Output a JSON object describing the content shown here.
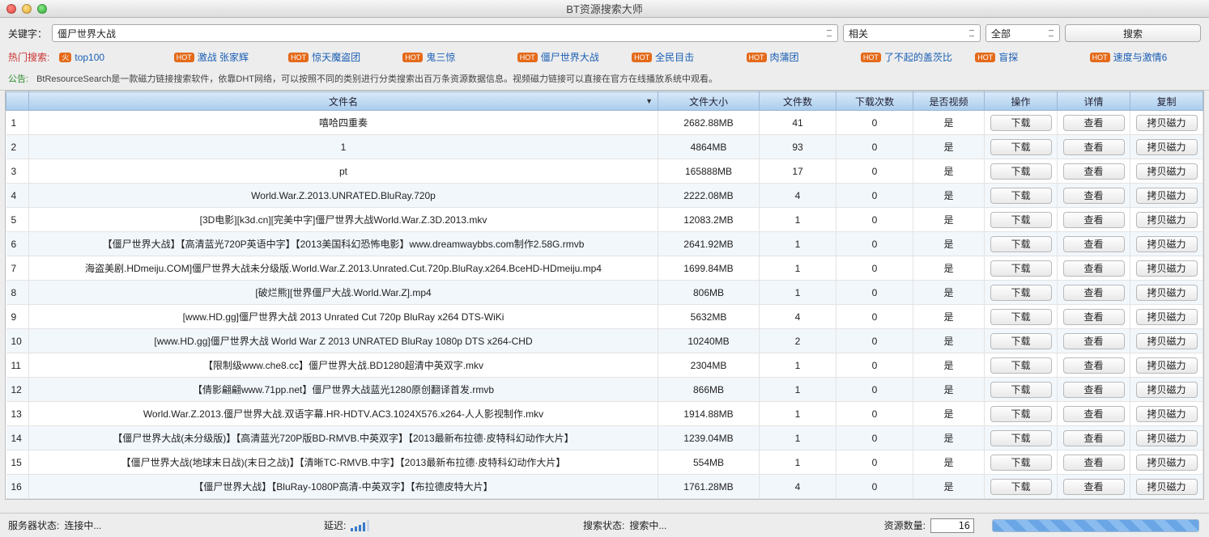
{
  "window": {
    "title": "BT资源搜索大师"
  },
  "search": {
    "keyword_label": "关键字：",
    "keyword_value": "僵尸世界大战",
    "sort_value": "相关",
    "filter_value": "全部",
    "button": "搜索"
  },
  "hot": {
    "label": "热门搜索:",
    "items": [
      {
        "badge_text": "火",
        "text": "top100"
      },
      {
        "badge_text": "HOT",
        "text": "激战 张家辉"
      },
      {
        "badge_text": "HOT",
        "text": "惊天魔盗团"
      },
      {
        "badge_text": "HOT",
        "text": "鬼三惊"
      },
      {
        "badge_text": "HOT",
        "text": "僵尸世界大战"
      },
      {
        "badge_text": "HOT",
        "text": "全民目击"
      },
      {
        "badge_text": "HOT",
        "text": "肉蒲团"
      },
      {
        "badge_text": "HOT",
        "text": "了不起的盖茨比"
      },
      {
        "badge_text": "HOT",
        "text": "盲探"
      },
      {
        "badge_text": "HOT",
        "text": "速度与激情6"
      }
    ]
  },
  "notice": {
    "label": "公告:",
    "text": "BtResourceSearch是一款磁力链接搜索软件，依靠DHT网络，可以按照不同的类别进行分类搜索出百万条资源数据信息。视频磁力链接可以直接在官方在线播放系统中观看。"
  },
  "table": {
    "headers": {
      "name": "文件名",
      "size": "文件大小",
      "files": "文件数",
      "downloads": "下载次数",
      "video": "是否视频",
      "action": "操作",
      "detail": "详情",
      "copy": "复制"
    },
    "buttons": {
      "download": "下载",
      "view": "查看",
      "copy": "拷贝磁力"
    },
    "rows": [
      {
        "idx": "1",
        "name": "嘻哈四重奏",
        "size": "2682.88MB",
        "files": "41",
        "dl": "0",
        "video": "是"
      },
      {
        "idx": "2",
        "name": "1",
        "size": "4864MB",
        "files": "93",
        "dl": "0",
        "video": "是"
      },
      {
        "idx": "3",
        "name": "pt",
        "size": "165888MB",
        "files": "17",
        "dl": "0",
        "video": "是"
      },
      {
        "idx": "4",
        "name": "World.War.Z.2013.UNRATED.BluRay.720p",
        "size": "2222.08MB",
        "files": "4",
        "dl": "0",
        "video": "是"
      },
      {
        "idx": "5",
        "name": "[3D电影][k3d.cn][完美中字]僵尸世界大战World.War.Z.3D.2013.mkv",
        "size": "12083.2MB",
        "files": "1",
        "dl": "0",
        "video": "是"
      },
      {
        "idx": "6",
        "name": "【僵尸世界大战】【高清蓝光720P英语中字】【2013美国科幻恐怖电影】www.dreamwaybbs.com制作2.58G.rmvb",
        "size": "2641.92MB",
        "files": "1",
        "dl": "0",
        "video": "是"
      },
      {
        "idx": "7",
        "name": "海盗美剧.HDmeiju.COM]僵尸世界大战未分级版.World.War.Z.2013.Unrated.Cut.720p.BluRay.x264.BceHD-HDmeiju.mp4",
        "size": "1699.84MB",
        "files": "1",
        "dl": "0",
        "video": "是"
      },
      {
        "idx": "8",
        "name": "[破烂熊][世界僵尸大战.World.War.Z].mp4",
        "size": "806MB",
        "files": "1",
        "dl": "0",
        "video": "是"
      },
      {
        "idx": "9",
        "name": "[www.HD.gg]僵尸世界大战 2013 Unrated Cut 720p BluRay x264 DTS-WiKi",
        "size": "5632MB",
        "files": "4",
        "dl": "0",
        "video": "是"
      },
      {
        "idx": "10",
        "name": "[www.HD.gg]僵尸世界大战 World War Z 2013 UNRATED BluRay 1080p DTS x264-CHD",
        "size": "10240MB",
        "files": "2",
        "dl": "0",
        "video": "是"
      },
      {
        "idx": "11",
        "name": "【限制级www.che8.cc】僵尸世界大战.BD1280超清中英双字.mkv",
        "size": "2304MB",
        "files": "1",
        "dl": "0",
        "video": "是"
      },
      {
        "idx": "12",
        "name": "【倩影翩翩www.71pp.net】僵尸世界大战蓝光1280原创翻译首发.rmvb",
        "size": "866MB",
        "files": "1",
        "dl": "0",
        "video": "是"
      },
      {
        "idx": "13",
        "name": "World.War.Z.2013.僵尸世界大战.双语字幕.HR-HDTV.AC3.1024X576.x264-人人影视制作.mkv",
        "size": "1914.88MB",
        "files": "1",
        "dl": "0",
        "video": "是"
      },
      {
        "idx": "14",
        "name": "【僵尸世界大战(未分级版)】【高清蓝光720P版BD-RMVB.中英双字】【2013最新布拉德·皮特科幻动作大片】",
        "size": "1239.04MB",
        "files": "1",
        "dl": "0",
        "video": "是"
      },
      {
        "idx": "15",
        "name": "【僵尸世界大战(地球末日战)(末日之战)】【清晰TC-RMVB.中字】【2013最新布拉德·皮特科幻动作大片】",
        "size": "554MB",
        "files": "1",
        "dl": "0",
        "video": "是"
      },
      {
        "idx": "16",
        "name": "【僵尸世界大战】【BluRay-1080P高清-中英双字】【布拉德皮特大片】",
        "size": "1761.28MB",
        "files": "4",
        "dl": "0",
        "video": "是"
      }
    ]
  },
  "status": {
    "server_label": "服务器状态:",
    "server_value": "连接中...",
    "latency_label": "延迟:",
    "search_label": "搜索状态:",
    "search_value": "搜索中...",
    "count_label": "资源数量:",
    "count_value": "16"
  }
}
